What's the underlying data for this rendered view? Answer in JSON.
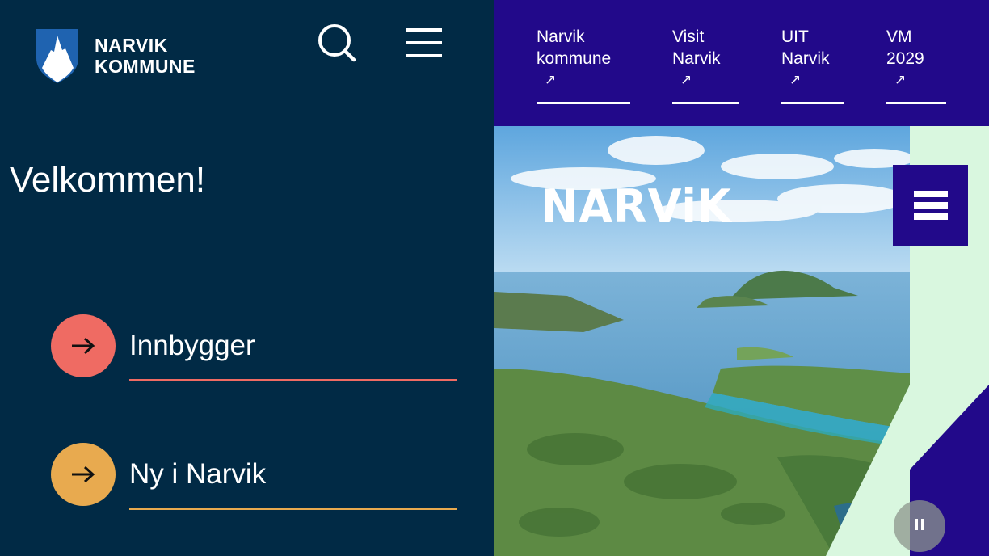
{
  "brand": {
    "line1": "NARVIK",
    "line2": "KOMMUNE"
  },
  "header": {
    "search_icon": "search-icon",
    "menu_icon": "hamburger-menu-icon"
  },
  "welcome": "Velkommen!",
  "categories": [
    {
      "label": "Innbygger",
      "color": "#ef6b63",
      "icon": "arrow-right-icon"
    },
    {
      "label": "Ny i Narvik",
      "color": "#e8aa4f",
      "icon": "arrow-right-icon"
    }
  ],
  "topnav": [
    {
      "line1": "Narvik",
      "line2": "kommune",
      "icon": "↗"
    },
    {
      "line1": "Visit",
      "line2": "Narvik",
      "icon": "↗"
    },
    {
      "line1": "UIT",
      "line2": "Narvik",
      "icon": "↗"
    },
    {
      "line1": "VM",
      "line2": "2029",
      "icon": "↗"
    }
  ],
  "hero": {
    "wordmark": "NARViK"
  },
  "colors": {
    "left_bg": "#012a45",
    "nav_bg": "#22098a",
    "strip_bg": "#d9f7df"
  }
}
